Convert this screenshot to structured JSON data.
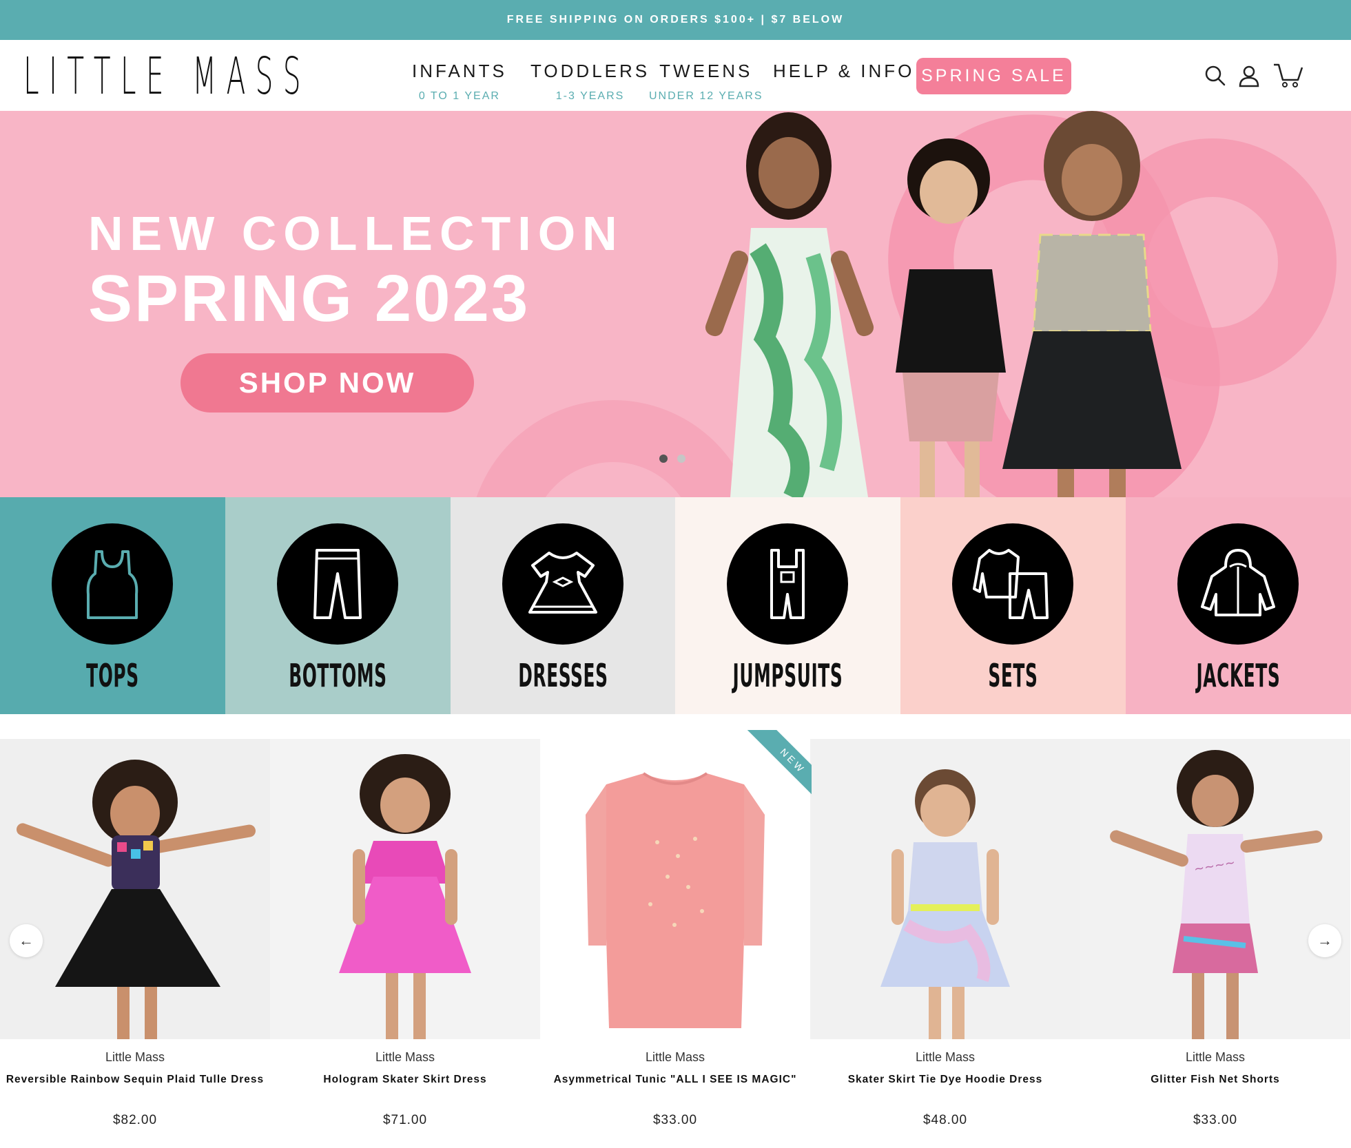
{
  "announcement": "FREE SHIPPING ON ORDERS $100+ | $7 BELOW",
  "logo": "LITTLE MASS",
  "nav": [
    {
      "label": "INFANTS",
      "sub": "0 TO 1 YEAR"
    },
    {
      "label": "TODDLERS",
      "sub": "1-3 YEARS"
    },
    {
      "label": "TWEENS",
      "sub": "UNDER 12 YEARS"
    },
    {
      "label": "HELP & INFO",
      "sub": ""
    }
  ],
  "sale_button": "SPRING SALE",
  "header_icons": [
    "search-icon",
    "account-icon",
    "cart-icon"
  ],
  "hero": {
    "line1": "NEW COLLECTION",
    "line2": "SPRING 2023",
    "cta": "SHOP NOW",
    "slides": 2,
    "active_slide": 1
  },
  "categories": [
    {
      "label": "TOPS",
      "icon": "tank-top-icon",
      "bg": "#57abae"
    },
    {
      "label": "BOTTOMS",
      "icon": "pants-icon",
      "bg": "#a9cdc9"
    },
    {
      "label": "DRESSES",
      "icon": "dress-icon",
      "bg": "#e6e6e6"
    },
    {
      "label": "JUMPSUITS",
      "icon": "overalls-icon",
      "bg": "#fbf3ef"
    },
    {
      "label": "SETS",
      "icon": "set-icon",
      "bg": "#fbd0cb"
    },
    {
      "label": "JACKETS",
      "icon": "jacket-icon",
      "bg": "#f7b2c3"
    }
  ],
  "products": [
    {
      "brand": "Little Mass",
      "title": "Reversible Rainbow Sequin Plaid Tulle Dress",
      "price": "$82.00"
    },
    {
      "brand": "Little Mass",
      "title": "Hologram Skater Skirt Dress",
      "price": "$71.00"
    },
    {
      "brand": "Little Mass",
      "title": "Asymmetrical Tunic \"ALL I SEE IS MAGIC\"",
      "price": "$33.00",
      "badge": "NEW"
    },
    {
      "brand": "Little Mass",
      "title": "Skater Skirt Tie Dye Hoodie Dress",
      "price": "$48.00"
    },
    {
      "brand": "Little Mass",
      "title": "Glitter Fish Net Shorts",
      "price": "$33.00"
    }
  ],
  "carousel": {
    "prev": "←",
    "next": "→"
  },
  "colors": {
    "teal": "#5aadb0",
    "pink": "#f47f99",
    "hero_bg": "#f8b5c6"
  }
}
